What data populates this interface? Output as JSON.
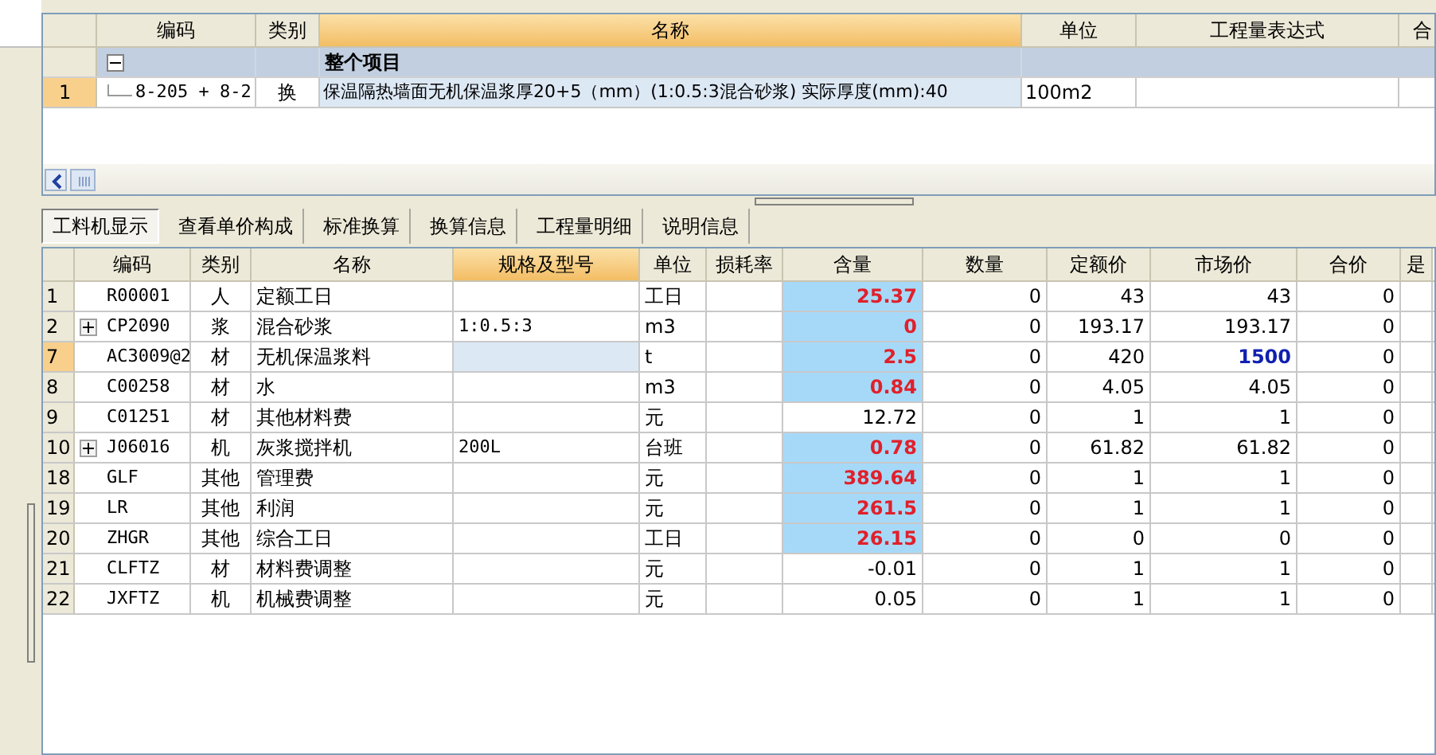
{
  "top_table": {
    "columns": [
      {
        "selected": false
      },
      {
        "label": "编码",
        "selected": false
      },
      {
        "label": "类别",
        "selected": false
      },
      {
        "label": "名称",
        "selected": true
      },
      {
        "label": "单位",
        "selected": false
      },
      {
        "label": "工程量表达式",
        "selected": false
      },
      {
        "label": "合",
        "selected": false
      }
    ],
    "group": {
      "title": "整个项目",
      "expanded": true
    },
    "rows": [
      {
        "num": "1",
        "code": "8-205 + 8-2",
        "type": "换",
        "name": "保温隔热墙面无机保温浆厚20+5（mm）(1:0.5:3混合砂浆) 实际厚度(mm):40",
        "unit": "100m2",
        "selected": true
      }
    ]
  },
  "tabs": [
    {
      "label": "工料机显示",
      "selected": true
    },
    {
      "label": "查看单价构成",
      "selected": false
    },
    {
      "label": "标准换算",
      "selected": false
    },
    {
      "label": "换算信息",
      "selected": false
    },
    {
      "label": "工程量明细",
      "selected": false
    },
    {
      "label": "说明信息",
      "selected": false
    }
  ],
  "bottom_table": {
    "columns": [
      {
        "selected": false
      },
      {
        "label": "编码",
        "selected": false
      },
      {
        "label": "类别",
        "selected": false
      },
      {
        "label": "名称",
        "selected": false
      },
      {
        "label": "规格及型号",
        "selected": true
      },
      {
        "label": "单位",
        "selected": false
      },
      {
        "label": "损耗率",
        "selected": false
      },
      {
        "label": "含量",
        "selected": false
      },
      {
        "label": "数量",
        "selected": false
      },
      {
        "label": "定额价",
        "selected": false
      },
      {
        "label": "市场价",
        "selected": false
      },
      {
        "label": "合价",
        "selected": false
      },
      {
        "label": "是",
        "selected": false
      }
    ],
    "rows": [
      {
        "num": "1",
        "expandable": false,
        "code": "R00001",
        "type": "人",
        "name": "定额工日",
        "spec": "",
        "unit": "工日",
        "content": "25.37",
        "content_modified": true,
        "qty": "0",
        "quota_price": "43",
        "market_price": "43",
        "market_modified": false,
        "total": "0",
        "selected": false
      },
      {
        "num": "2",
        "expandable": true,
        "code": "CP2090",
        "type": "浆",
        "name": "混合砂浆",
        "spec": "1:0.5:3",
        "unit": "m3",
        "content": "0",
        "content_modified": true,
        "qty": "0",
        "quota_price": "193.17",
        "market_price": "193.17",
        "market_modified": false,
        "total": "0",
        "selected": false
      },
      {
        "num": "7",
        "expandable": false,
        "code": "AC3009@2",
        "type": "材",
        "name": "无机保温浆料",
        "spec": "",
        "unit": "t",
        "content": "2.5",
        "content_modified": true,
        "qty": "0",
        "quota_price": "420",
        "market_price": "1500",
        "market_modified": true,
        "total": "0",
        "selected": true
      },
      {
        "num": "8",
        "expandable": false,
        "code": "C00258",
        "type": "材",
        "name": "水",
        "spec": "",
        "unit": "m3",
        "content": "0.84",
        "content_modified": true,
        "qty": "0",
        "quota_price": "4.05",
        "market_price": "4.05",
        "market_modified": false,
        "total": "0",
        "selected": false
      },
      {
        "num": "9",
        "expandable": false,
        "code": "C01251",
        "type": "材",
        "name": "其他材料费",
        "spec": "",
        "unit": "元",
        "content": "12.72",
        "content_modified": false,
        "qty": "0",
        "quota_price": "1",
        "market_price": "1",
        "market_modified": false,
        "total": "0",
        "selected": false
      },
      {
        "num": "10",
        "expandable": true,
        "code": "J06016",
        "type": "机",
        "name": "灰浆搅拌机",
        "spec": "200L",
        "unit": "台班",
        "content": "0.78",
        "content_modified": true,
        "qty": "0",
        "quota_price": "61.82",
        "market_price": "61.82",
        "market_modified": false,
        "total": "0",
        "selected": false
      },
      {
        "num": "18",
        "expandable": false,
        "code": "GLF",
        "type": "其他",
        "name": "管理费",
        "spec": "",
        "unit": "元",
        "content": "389.64",
        "content_modified": true,
        "qty": "0",
        "quota_price": "1",
        "market_price": "1",
        "market_modified": false,
        "total": "0",
        "selected": false
      },
      {
        "num": "19",
        "expandable": false,
        "code": "LR",
        "type": "其他",
        "name": "利润",
        "spec": "",
        "unit": "元",
        "content": "261.5",
        "content_modified": true,
        "qty": "0",
        "quota_price": "1",
        "market_price": "1",
        "market_modified": false,
        "total": "0",
        "selected": false
      },
      {
        "num": "20",
        "expandable": false,
        "code": "ZHGR",
        "type": "其他",
        "name": "综合工日",
        "spec": "",
        "unit": "工日",
        "content": "26.15",
        "content_modified": true,
        "qty": "0",
        "quota_price": "0",
        "market_price": "0",
        "market_modified": false,
        "total": "0",
        "selected": false
      },
      {
        "num": "21",
        "expandable": false,
        "code": "CLFTZ",
        "type": "材",
        "name": "材料费调整",
        "spec": "",
        "unit": "元",
        "content": "-0.01",
        "content_modified": false,
        "qty": "0",
        "quota_price": "1",
        "market_price": "1",
        "market_modified": false,
        "total": "0",
        "selected": false
      },
      {
        "num": "22",
        "expandable": false,
        "code": "JXFTZ",
        "type": "机",
        "name": "机械费调整",
        "spec": "",
        "unit": "元",
        "content": "0.05",
        "content_modified": false,
        "qty": "0",
        "quota_price": "1",
        "market_price": "1",
        "market_modified": false,
        "total": "0",
        "selected": false
      }
    ]
  }
}
